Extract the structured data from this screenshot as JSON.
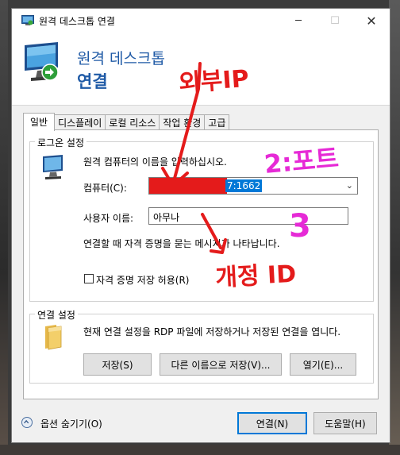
{
  "window": {
    "title": "원격 데스크톱 연결",
    "min_glyph": "─",
    "max_glyph": "☐",
    "close_glyph": "✕"
  },
  "header": {
    "title_line1": "원격 데스크톱",
    "title_line2": "연결"
  },
  "tabs": [
    {
      "label": "일반",
      "active": true
    },
    {
      "label": "디스플레이"
    },
    {
      "label": "로컬 리소스"
    },
    {
      "label": "작업 환경"
    },
    {
      "label": "고급"
    }
  ],
  "logon": {
    "group_label": "로그온 설정",
    "instruction": "원격 컴퓨터의 이름을 입력하십시오.",
    "computer_label": "컴퓨터(C):",
    "computer_value_visible": "7:1662",
    "username_label": "사용자 이름:",
    "username_value": "아무나",
    "credentials_note": "연결할 때 자격 증명을 묻는 메시지가 나타납니다.",
    "save_credentials_label": "자격 증명 저장 허용(R)",
    "save_credentials_checked": false
  },
  "connection": {
    "group_label": "연결 설정",
    "description": "현재 연결 설정을 RDP 파일에 저장하거나 저장된 연결을 엽니다.",
    "save_button": "저장(S)",
    "save_as_button": "다른 이름으로 저장(V)...",
    "open_button": "열기(E)..."
  },
  "footer": {
    "options_label": "옵션 숨기기(O)",
    "connect_button": "연결(N)",
    "help_button": "도움말(H)"
  },
  "annotations": {
    "external_ip": "외부IP",
    "port": "2:포트",
    "num3": "3",
    "personal_ip": "개정 ID"
  },
  "colors": {
    "accent": "#0078d7",
    "title_blue": "#1f5aa6",
    "annotation_red": "#e41b1b",
    "annotation_magenta": "#e62ad6"
  }
}
